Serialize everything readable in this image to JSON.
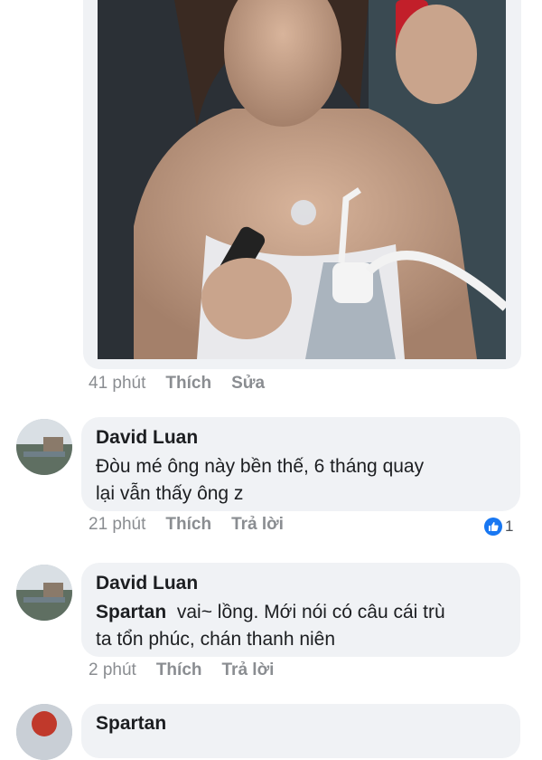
{
  "post": {
    "meta": {
      "time": "41 phút",
      "like": "Thích",
      "edit": "Sửa"
    }
  },
  "comments": [
    {
      "author": "David Luan",
      "text": "Đòu mé ông này bền thế, 6 tháng quay lại vẫn thấy ông z",
      "line1": "Đòu mé ông này bền thế, 6 tháng quay",
      "line2": "lại vẫn thấy ông z",
      "time": "21 phút",
      "like": "Thích",
      "reply": "Trả lời",
      "reaction_count": "1"
    },
    {
      "author": "David Luan",
      "mention": "Spartan",
      "line1_rest": "vai~ lồng. Mới nói có câu cái trù",
      "line2": "ta tổn phúc, chán thanh niên",
      "time": "2 phút",
      "like": "Thích",
      "reply": "Trả lời"
    },
    {
      "author": "Spartan"
    }
  ],
  "colors": {
    "bubble": "#f0f2f5",
    "meta_text": "#8a8d91",
    "like_blue": "#1877f2"
  },
  "icons": {
    "reaction": "thumbs-up-icon"
  }
}
